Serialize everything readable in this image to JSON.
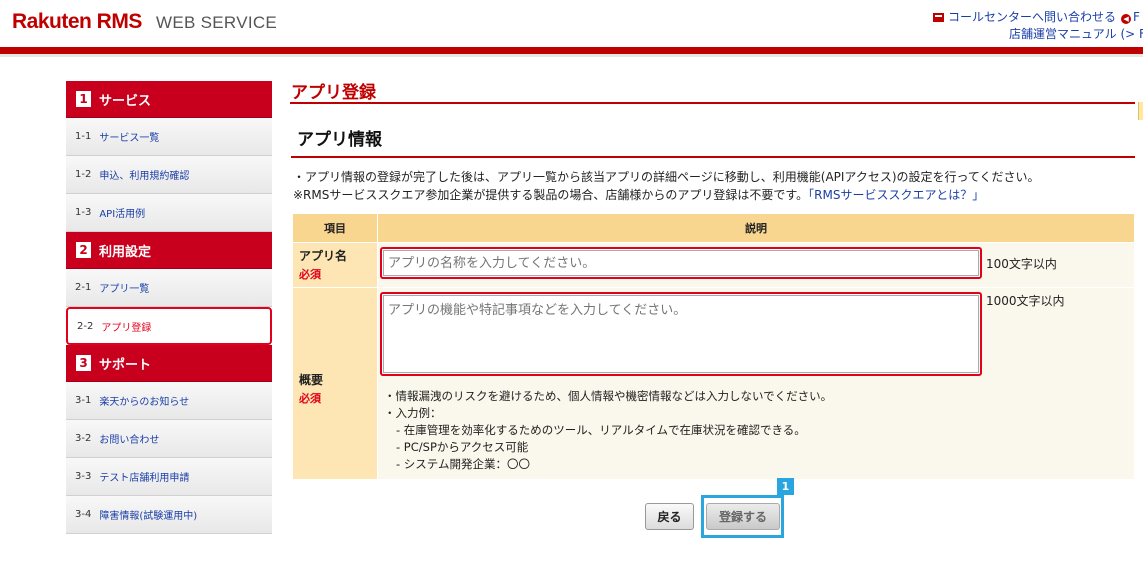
{
  "header": {
    "logo": "Rakuten RMS",
    "logo_sub": "WEB SERVICE",
    "callcenter_link": "コールセンターへ問い合わせる",
    "callcenter_tail": "F",
    "manual_link": "店舗運営マニュアル (> F",
    "accent_color": "#bf0000",
    "icons": [
      "mail-icon",
      "back-arrow-icon"
    ]
  },
  "sidebar": {
    "sections": [
      {
        "num": "1",
        "title": "サービス",
        "items": [
          {
            "num": "1-1",
            "label": "サービス一覧"
          },
          {
            "num": "1-2",
            "label": "申込、利用規約確認"
          },
          {
            "num": "1-3",
            "label": "API活用例"
          }
        ]
      },
      {
        "num": "2",
        "title": "利用設定",
        "items": [
          {
            "num": "2-1",
            "label": "アプリ一覧"
          },
          {
            "num": "2-2",
            "label": "アプリ登録",
            "active": true
          }
        ]
      },
      {
        "num": "3",
        "title": "サポート",
        "items": [
          {
            "num": "3-1",
            "label": "楽天からのお知らせ"
          },
          {
            "num": "3-2",
            "label": "お問い合わせ"
          },
          {
            "num": "3-3",
            "label": "テスト店舗利用申請"
          },
          {
            "num": "3-4",
            "label": "障害情報(試験運用中)"
          }
        ]
      }
    ]
  },
  "main": {
    "page_title": "アプリ登録",
    "section_title": "アプリ情報",
    "notice1": "・アプリ情報の登録が完了した後は、アプリ一覧から該当アプリの詳細ページに移動し、利用機能(APIアクセス)の設定を行ってください。",
    "notice2": "※RMSサービススクエア参加企業が提供する製品の場合、店舗様からのアプリ登録は不要です。",
    "notice2_link": "「RMSサービススクエアとは？」",
    "table": {
      "col_item": "項目",
      "col_desc": "説明",
      "app_name_label": "アプリ名",
      "app_name_required": "必須",
      "app_name_placeholder": "アプリの名称を入力してください。",
      "app_name_value": "",
      "app_name_limit": "100文字以内",
      "summary_label": "概要",
      "summary_required": "必須",
      "summary_placeholder": "アプリの機能や特記事項などを入力してください。",
      "summary_value": "",
      "summary_limit": "1000文字以内",
      "notes": [
        "・情報漏洩のリスクを避けるため、個人情報や機密情報などは入力しないでください。",
        "・入力例：",
        "- 在庫管理を効率化するためのツール、リアルタイムで在庫状況を確認できる。",
        "- PC/SPからアクセス可能",
        "- システム開発企業：〇〇"
      ]
    },
    "back_button": "戻る",
    "submit_button": "登録する",
    "step_badge": "1",
    "focus_color": "#29a6e0"
  }
}
